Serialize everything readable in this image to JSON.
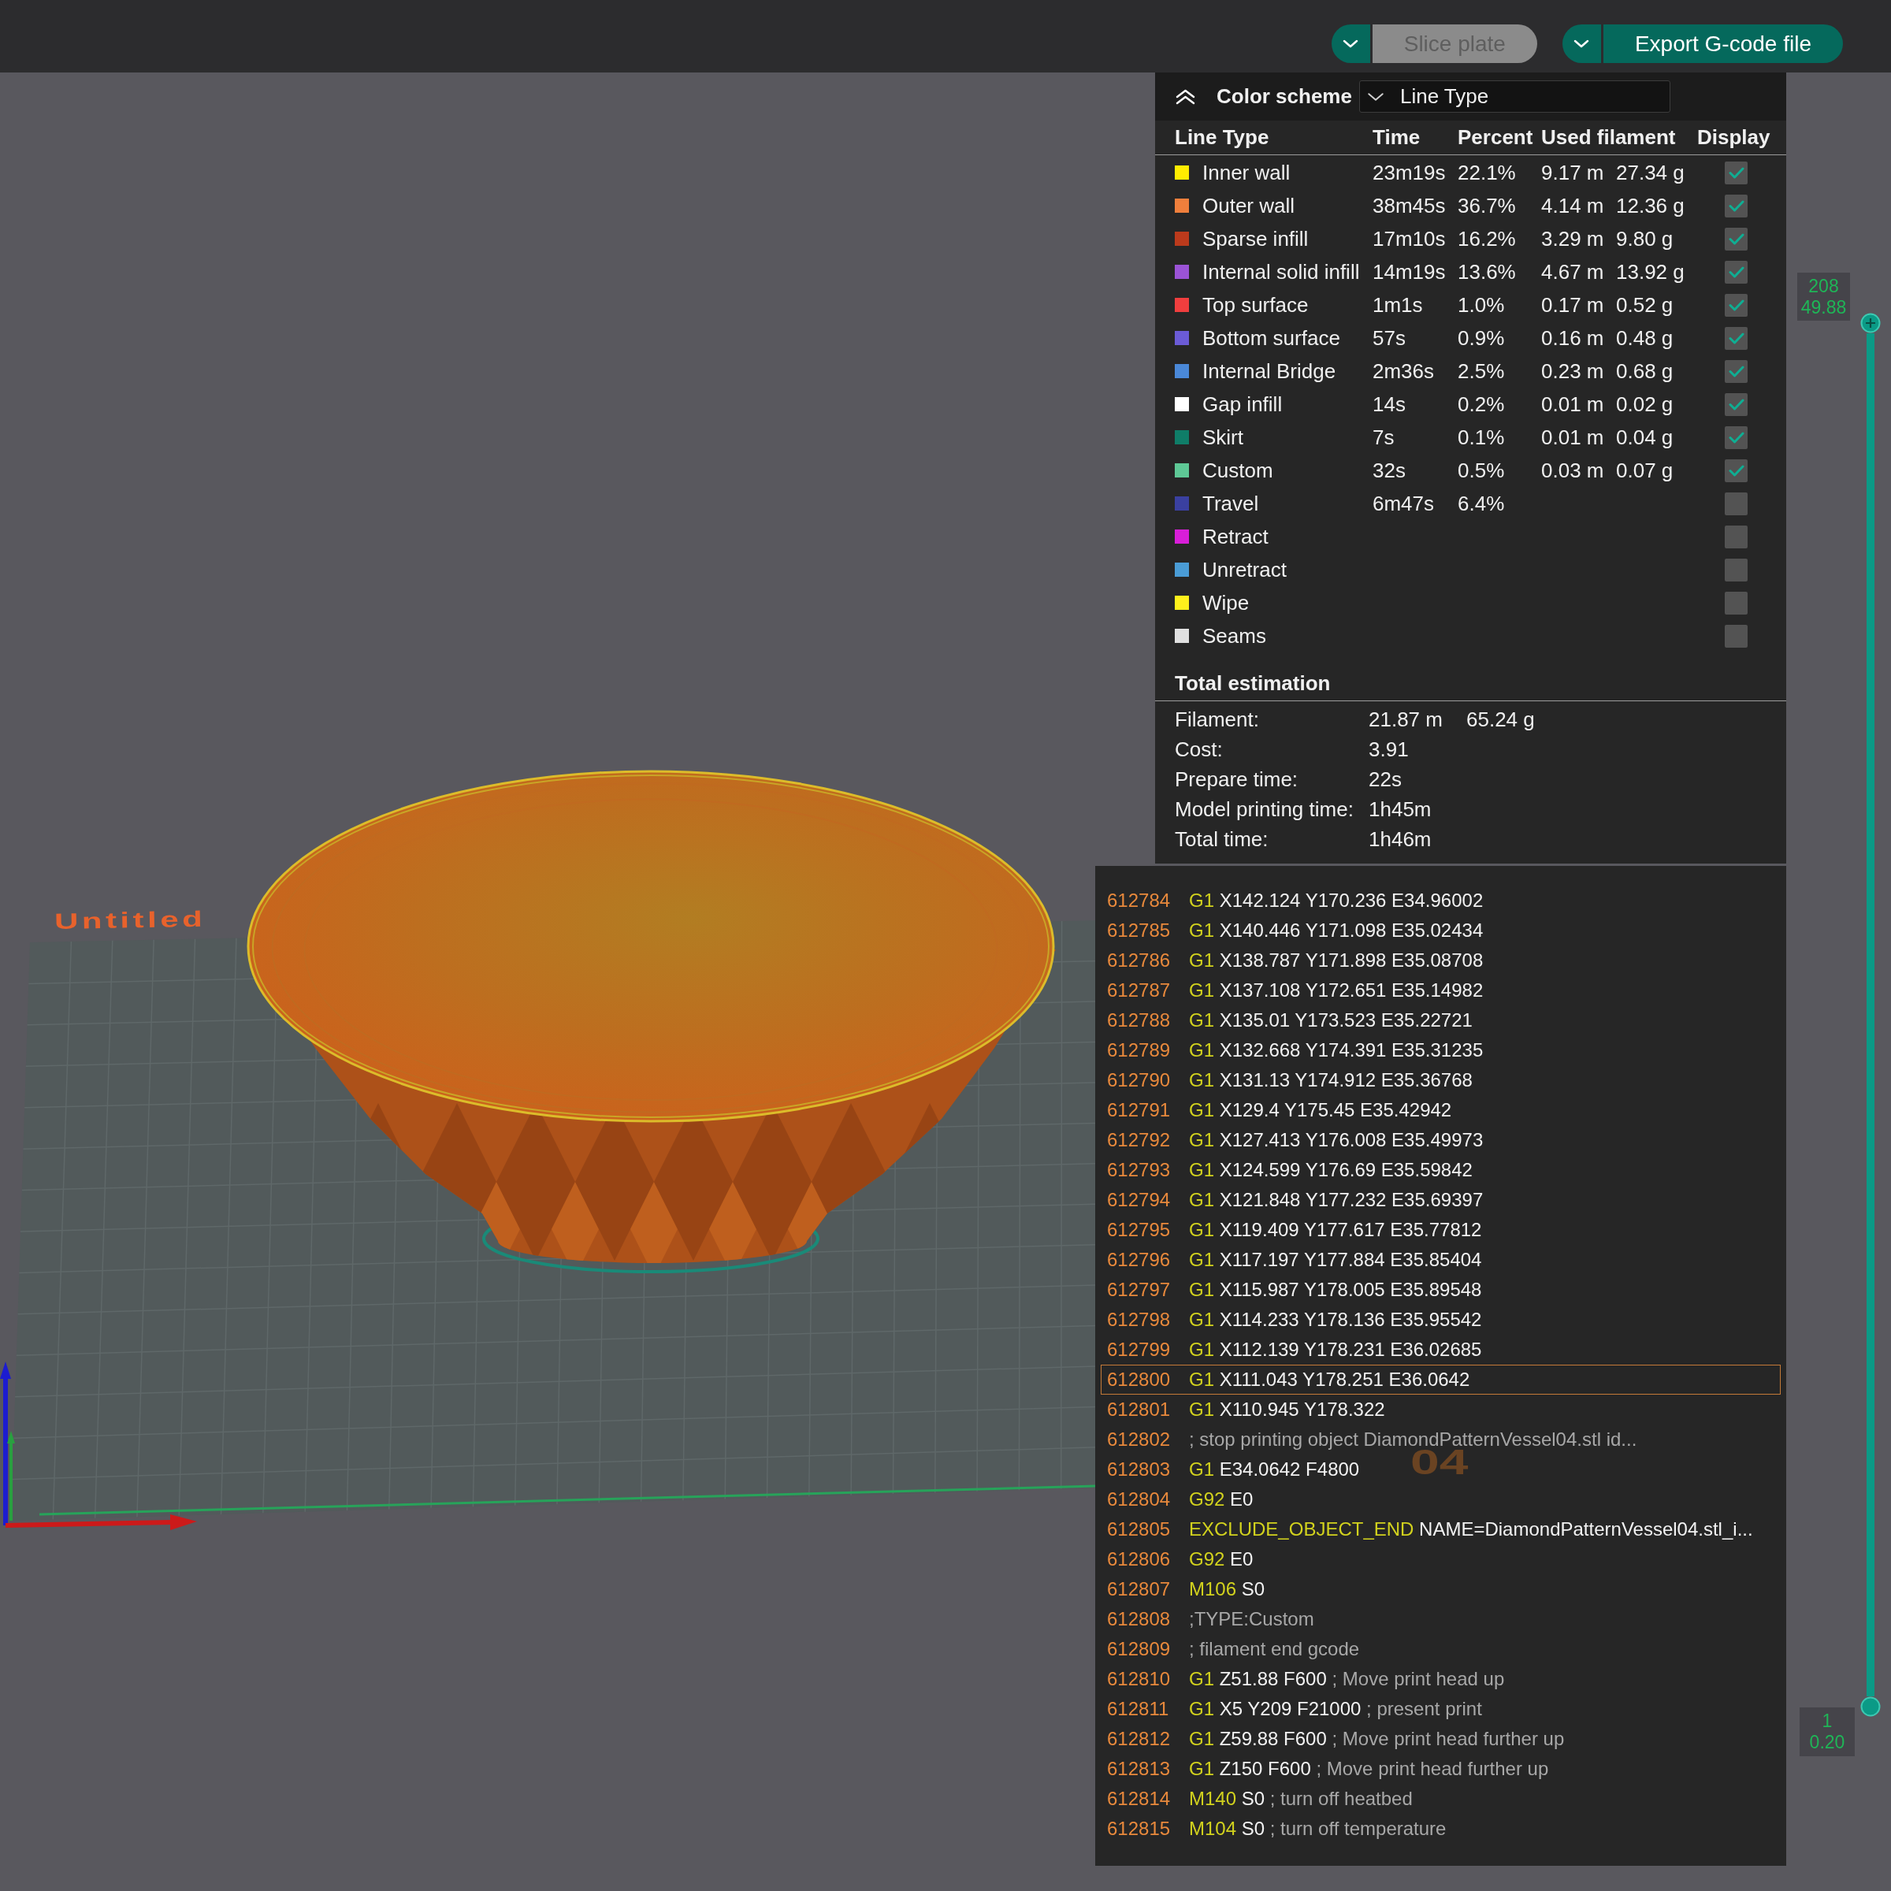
{
  "toolbar": {
    "buttons": [
      {
        "label": "Slice plate",
        "disabled": true
      },
      {
        "label": "Export G-code file",
        "disabled": false
      }
    ]
  },
  "viewport": {
    "plate_name": "Untitled",
    "plate_number": "04"
  },
  "legend": {
    "title": "Color scheme",
    "scheme": "Line Type",
    "columns": [
      "Line Type",
      "Time",
      "Percent",
      "Used filament",
      "Display"
    ],
    "rows": [
      {
        "name": "Inner wall",
        "color": "#ffec00",
        "time": "23m19s",
        "percent": "22.1%",
        "length": "9.17 m",
        "weight": "27.34 g",
        "checked": true
      },
      {
        "name": "Outer wall",
        "color": "#ef7f3c",
        "time": "38m45s",
        "percent": "36.7%",
        "length": "4.14 m",
        "weight": "12.36 g",
        "checked": true
      },
      {
        "name": "Sparse infill",
        "color": "#bb3a1c",
        "time": "17m10s",
        "percent": "16.2%",
        "length": "3.29 m",
        "weight": "9.80 g",
        "checked": true
      },
      {
        "name": "Internal solid infill",
        "color": "#9b53d6",
        "time": "14m19s",
        "percent": "13.6%",
        "length": "4.67 m",
        "weight": "13.92 g",
        "checked": true
      },
      {
        "name": "Top surface",
        "color": "#f03e3e",
        "time": "1m1s",
        "percent": "1.0%",
        "length": "0.17 m",
        "weight": "0.52 g",
        "checked": true
      },
      {
        "name": "Bottom surface",
        "color": "#6b5bd6",
        "time": "57s",
        "percent": "0.9%",
        "length": "0.16 m",
        "weight": "0.48 g",
        "checked": true
      },
      {
        "name": "Internal Bridge",
        "color": "#4a88d8",
        "time": "2m36s",
        "percent": "2.5%",
        "length": "0.23 m",
        "weight": "0.68 g",
        "checked": true
      },
      {
        "name": "Gap infill",
        "color": "#ffffff",
        "time": "14s",
        "percent": "0.2%",
        "length": "0.01 m",
        "weight": "0.02 g",
        "checked": true
      },
      {
        "name": "Skirt",
        "color": "#0f7d68",
        "time": "7s",
        "percent": "0.1%",
        "length": "0.01 m",
        "weight": "0.04 g",
        "checked": true
      },
      {
        "name": "Custom",
        "color": "#5ec896",
        "time": "32s",
        "percent": "0.5%",
        "length": "0.03 m",
        "weight": "0.07 g",
        "checked": true
      },
      {
        "name": "Travel",
        "color": "#3a40a0",
        "time": "6m47s",
        "percent": "6.4%",
        "checked": false
      },
      {
        "name": "Retract",
        "color": "#d81ed8",
        "checked": false
      },
      {
        "name": "Unretract",
        "color": "#4a9cd6",
        "checked": false
      },
      {
        "name": "Wipe",
        "color": "#fff01c",
        "checked": false
      },
      {
        "name": "Seams",
        "color": "#e0e0e0",
        "checked": false
      }
    ],
    "totals": {
      "title": "Total estimation",
      "rows": [
        {
          "label": "Filament:",
          "values": [
            "21.87 m",
            "65.24 g"
          ]
        },
        {
          "label": "Cost:",
          "values": [
            "3.91"
          ]
        },
        {
          "label": "Prepare time:",
          "values": [
            "22s"
          ]
        },
        {
          "label": "Model printing time:",
          "values": [
            "1h45m"
          ]
        },
        {
          "label": "Total time:",
          "values": [
            "1h46m"
          ]
        }
      ]
    }
  },
  "gcode": {
    "lines": [
      {
        "number": "612784",
        "command": "G1",
        "args": "X142.124 Y170.236 E34.96002",
        "selected": false
      },
      {
        "number": "612785",
        "command": "G1",
        "args": "X140.446 Y171.098 E35.02434",
        "selected": false
      },
      {
        "number": "612786",
        "command": "G1",
        "args": "X138.787 Y171.898 E35.08708",
        "selected": false
      },
      {
        "number": "612787",
        "command": "G1",
        "args": "X137.108 Y172.651 E35.14982",
        "selected": false
      },
      {
        "number": "612788",
        "command": "G1",
        "args": "X135.01 Y173.523 E35.22721",
        "selected": false
      },
      {
        "number": "612789",
        "command": "G1",
        "args": "X132.668 Y174.391 E35.31235",
        "selected": false
      },
      {
        "number": "612790",
        "command": "G1",
        "args": "X131.13 Y174.912 E35.36768",
        "selected": false
      },
      {
        "number": "612791",
        "command": "G1",
        "args": "X129.4 Y175.45 E35.42942",
        "selected": false
      },
      {
        "number": "612792",
        "command": "G1",
        "args": "X127.413 Y176.008 E35.49973",
        "selected": false
      },
      {
        "number": "612793",
        "command": "G1",
        "args": "X124.599 Y176.69 E35.59842",
        "selected": false
      },
      {
        "number": "612794",
        "command": "G1",
        "args": "X121.848 Y177.232 E35.69397",
        "selected": false
      },
      {
        "number": "612795",
        "command": "G1",
        "args": "X119.409 Y177.617 E35.77812",
        "selected": false
      },
      {
        "number": "612796",
        "command": "G1",
        "args": "X117.197 Y177.884 E35.85404",
        "selected": false
      },
      {
        "number": "612797",
        "command": "G1",
        "args": "X115.987 Y178.005 E35.89548",
        "selected": false
      },
      {
        "number": "612798",
        "command": "G1",
        "args": "X114.233 Y178.136 E35.95542",
        "selected": false
      },
      {
        "number": "612799",
        "command": "G1",
        "args": "X112.139 Y178.231 E36.02685",
        "selected": false
      },
      {
        "number": "612800",
        "command": "G1",
        "args": "X111.043 Y178.251 E36.0642",
        "selected": true
      },
      {
        "number": "612801",
        "command": "G1",
        "args": "X110.945 Y178.322",
        "selected": false
      },
      {
        "number": "612802",
        "comment": "; stop printing object DiamondPatternVessel04.stl id...",
        "selected": false
      },
      {
        "number": "612803",
        "command": "G1",
        "args": "E34.0642 F4800",
        "selected": false
      },
      {
        "number": "612804",
        "command": "G92",
        "args": "E0",
        "selected": false
      },
      {
        "number": "612805",
        "command": "EXCLUDE_OBJECT_END",
        "args": "NAME=DiamondPatternVessel04.stl_i...",
        "selected": false
      },
      {
        "number": "612806",
        "command": "G92",
        "args": "E0",
        "selected": false
      },
      {
        "number": "612807",
        "command": "M106",
        "args": "S0",
        "selected": false
      },
      {
        "number": "612808",
        "comment": ";TYPE:Custom",
        "selected": false
      },
      {
        "number": "612809",
        "comment": "; filament end gcode",
        "selected": false
      },
      {
        "number": "612810",
        "command": "G1",
        "args": "Z51.88 F600",
        "comment": "; Move print head up",
        "selected": false
      },
      {
        "number": "612811",
        "command": "G1",
        "args": "X5 Y209 F21000",
        "comment": "; present print",
        "selected": false
      },
      {
        "number": "612812",
        "command": "G1",
        "args": "Z59.88 F600",
        "comment": "; Move print head further up",
        "selected": false
      },
      {
        "number": "612813",
        "command": "G1",
        "args": "Z150 F600",
        "comment": "; Move print head further up",
        "selected": false
      },
      {
        "number": "612814",
        "command": "M140",
        "args": "S0",
        "comment": "; turn off heatbed",
        "selected": false
      },
      {
        "number": "612815",
        "command": "M104",
        "args": "S0",
        "comment": "; turn off temperature",
        "selected": false
      }
    ]
  },
  "layer_slider": {
    "top_label": [
      "208",
      "49.88"
    ],
    "bottom_label": [
      "1",
      "0.20"
    ],
    "level": 1
  }
}
